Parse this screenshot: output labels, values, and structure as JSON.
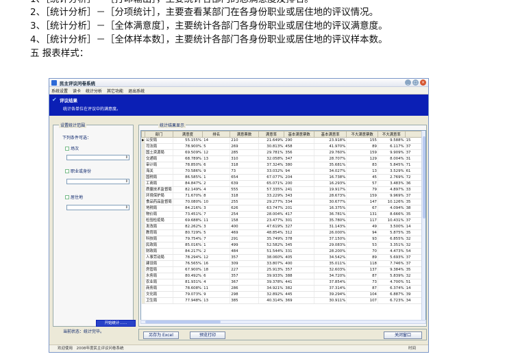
{
  "doc": {
    "line0": "1、［统计分析］－［打印输出］，主要统计各部门的总满意度及排名。",
    "line1": "2、［统计分析］－［分项统计］，主要查看某部门在各身份职业或居住地的评议情况。",
    "line2": "3、［统计分析］－［全体满意度］，主要统计各部门各身份职业或居住地的评议满意度。",
    "line3": "4、［统计分析］－［全体样本数］，主要统计各部门各身份职业或居住地的评议样本数。",
    "line4": "五 报表样式："
  },
  "window": {
    "title": "民主评议问卷系统",
    "buttons": [
      "_",
      "□",
      "×"
    ],
    "menu": [
      "系统设置",
      "读卡",
      "统计分析",
      "其它功能",
      "退出系统"
    ]
  },
  "banner": {
    "title": "评议结果",
    "subtitle": "统计各单位在评议中的满意度。"
  },
  "left": {
    "group": "设置统计范围",
    "hint": "下列条件可选：",
    "options": [
      "场次",
      "职业或身份",
      "居住地"
    ],
    "stat_button": "开始统计……",
    "status": "当前状态：统计完毕。"
  },
  "right": {
    "group": "统计结果显示",
    "columns": [
      "部门",
      "满意度",
      "排名",
      "满意票数",
      "满意率",
      "基本满意票数",
      "基本满意率",
      "不大满意票数",
      "不大满意率",
      ""
    ],
    "rows": [
      [
        "公安局",
        "55.155%",
        "14",
        "210",
        "21.649%",
        "290",
        "23.918%",
        "155",
        "9.588%",
        "15"
      ],
      [
        "司法局",
        "78.900%",
        "5",
        "269",
        "30.813%",
        "458",
        "41.970%",
        "89",
        "6.117%",
        "37"
      ],
      [
        "国土资源局",
        "69.509%",
        "12",
        "285",
        "29.781%",
        "356",
        "29.760%",
        "159",
        "9.909%",
        "37"
      ],
      [
        "交通局",
        "68.789%",
        "13",
        "310",
        "32.058%",
        "347",
        "28.707%",
        "129",
        "8.004%",
        "31"
      ],
      [
        "审计局",
        "78.850%",
        "6",
        "318",
        "37.324%",
        "380",
        "35.681%",
        "83",
        "5.845%",
        "71"
      ],
      [
        "海关",
        "70.586%",
        "9",
        "73",
        "33.032%",
        "94",
        "34.027%",
        "13",
        "3.529%",
        "61"
      ],
      [
        "国税局",
        "86.585%",
        "1",
        "654",
        "67.077%",
        "204",
        "16.738%",
        "45",
        "2.769%",
        "72"
      ],
      [
        "工商局",
        "84.847%",
        "2",
        "639",
        "65.071%",
        "200",
        "16.293%",
        "57",
        "3.483%",
        "36"
      ],
      [
        "质量技术监督局",
        "82.149%",
        "4",
        "555",
        "57.335%",
        "241",
        "19.917%",
        "79",
        "4.897%",
        "33"
      ],
      [
        "环境保护局",
        "71.670%",
        "8",
        "318",
        "33.229%",
        "343",
        "28.673%",
        "159",
        "9.969%",
        "37"
      ],
      [
        "食品药品监督局",
        "70.080%",
        "10",
        "255",
        "29.277%",
        "334",
        "30.677%",
        "147",
        "10.126%",
        "35"
      ],
      [
        "地税局",
        "84.216%",
        "3",
        "626",
        "63.747%",
        "201",
        "16.375%",
        "67",
        "4.094%",
        "38"
      ],
      [
        "物价局",
        "73.451%",
        "7",
        "254",
        "28.004%",
        "417",
        "36.781%",
        "131",
        "8.666%",
        "35"
      ],
      [
        "检验检疫局",
        "69.688%",
        "11",
        "158",
        "23.477%",
        "301",
        "35.780%",
        "117",
        "10.431%",
        "37"
      ],
      [
        "发改局",
        "82.262%",
        "3",
        "400",
        "47.619%",
        "327",
        "31.143%",
        "49",
        "3.500%",
        "14"
      ],
      [
        "教育局",
        "80.729%",
        "5",
        "469",
        "48.854%",
        "312",
        "26.000%",
        "94",
        "5.875%",
        "35"
      ],
      [
        "科技局",
        "79.754%",
        "7",
        "291",
        "35.749%",
        "378",
        "37.150%",
        "93",
        "6.855%",
        "32"
      ],
      [
        "民政局",
        "85.016%",
        "1",
        "499",
        "52.582%",
        "345",
        "29.083%",
        "53",
        "3.351%",
        "32"
      ],
      [
        "财政局",
        "84.217%",
        "2",
        "484",
        "51.544%",
        "331",
        "28.200%",
        "70",
        "4.473%",
        "54"
      ],
      [
        "人事劳动局",
        "78.294%",
        "12",
        "357",
        "38.060%",
        "405",
        "34.542%",
        "89",
        "5.693%",
        "37"
      ],
      [
        "建设局",
        "76.565%",
        "16",
        "309",
        "33.807%",
        "400",
        "35.011%",
        "118",
        "7.746%",
        "37"
      ],
      [
        "房管局",
        "67.900%",
        "18",
        "227",
        "25.913%",
        "357",
        "32.603%",
        "137",
        "9.384%",
        "35"
      ],
      [
        "水务局",
        "80.492%",
        "6",
        "357",
        "39.933%",
        "388",
        "34.720%",
        "87",
        "5.839%",
        "32"
      ],
      [
        "农业局",
        "81.931%",
        "4",
        "367",
        "39.378%",
        "441",
        "37.854%",
        "73",
        "4.700%",
        "51"
      ],
      [
        "商务局",
        "78.608%",
        "11",
        "286",
        "34.921%",
        "382",
        "37.314%",
        "87",
        "6.374%",
        "14"
      ],
      [
        "文化局",
        "79.073%",
        "9",
        "298",
        "32.892%",
        "445",
        "39.294%",
        "104",
        "6.887%",
        "39"
      ],
      [
        "卫生局",
        "77.948%",
        "13",
        "385",
        "40.314%",
        "369",
        "30.911%",
        "107",
        "6.723%",
        "34"
      ]
    ]
  },
  "bottom": {
    "export": "另存为 Excel",
    "preview": "预览打印",
    "close": "关闭窗口"
  },
  "statusbar": {
    "left": "欢迎使用　2008年度民主评议问卷系统",
    "right": "时间"
  }
}
